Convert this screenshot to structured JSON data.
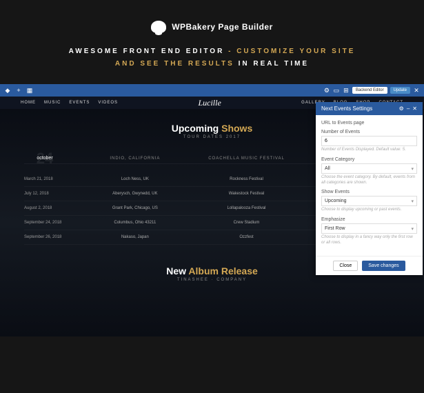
{
  "header": {
    "brand": "WPBakery Page Builder",
    "tagline_1a": "AWESOME FRONT END EDITOR",
    "tagline_1b": " - CUSTOMIZE YOUR SITE",
    "tagline_2a": "AND SEE THE RESULTS",
    "tagline_2b": " IN REAL TIME"
  },
  "toolbar": {
    "backend": "Backend Editor",
    "update": "Update"
  },
  "nav": {
    "items": [
      "HOME",
      "MUSIC",
      "EVENTS",
      "VIDEOS"
    ],
    "items2": [
      "GALLERY",
      "BLOG",
      "SHOP",
      "CONTACT"
    ],
    "logo": "Lucille"
  },
  "upcoming": {
    "title_a": "Upcoming ",
    "title_b": "Shows",
    "subtitle": "TOUR DATES 2017",
    "featured_month": "october",
    "featured_day": "24",
    "col1": "INDIO, CALIFORNIA",
    "col2": "COACHELLA MUSIC FESTIVAL",
    "rows": [
      {
        "date": "March 21, 2018",
        "loc": "Loch Ness, UK",
        "venue": "Rockness Festival"
      },
      {
        "date": "July 12, 2018",
        "loc": "Aberysch, Gwynedd, UK",
        "venue": "Wakestock Festival"
      },
      {
        "date": "August 2, 2018",
        "loc": "Grant Park, Chicago, US",
        "venue": "Lollapalooza Festival"
      },
      {
        "date": "September 24, 2018",
        "loc": "Columbus, Ohio 43211",
        "venue": "Crew Stadium"
      },
      {
        "date": "September 26, 2018",
        "loc": "Nakaso, Japan",
        "venue": "Ozzfest"
      }
    ]
  },
  "album": {
    "title_a": "New ",
    "title_b": "Album Release",
    "subtitle": "TINASHEE · COMPANY"
  },
  "panel": {
    "title": "Next Events Settings",
    "url_label": "URL to Events page",
    "num_label": "Number of Events",
    "num_value": "6",
    "num_help": "Number of Events Displayed. Default value: 5.",
    "cat_label": "Event Category",
    "cat_value": "All",
    "cat_help": "Choose the event category. By default, events from all categories are shown.",
    "show_label": "Show Events",
    "show_value": "Upcoming",
    "show_help": "Choose to display upcoming or past events.",
    "emph_label": "Emphasize",
    "emph_value": "First Row",
    "emph_help": "Choose to display in a fancy way only the first row or all rows.",
    "close": "Close",
    "save": "Save changes"
  }
}
